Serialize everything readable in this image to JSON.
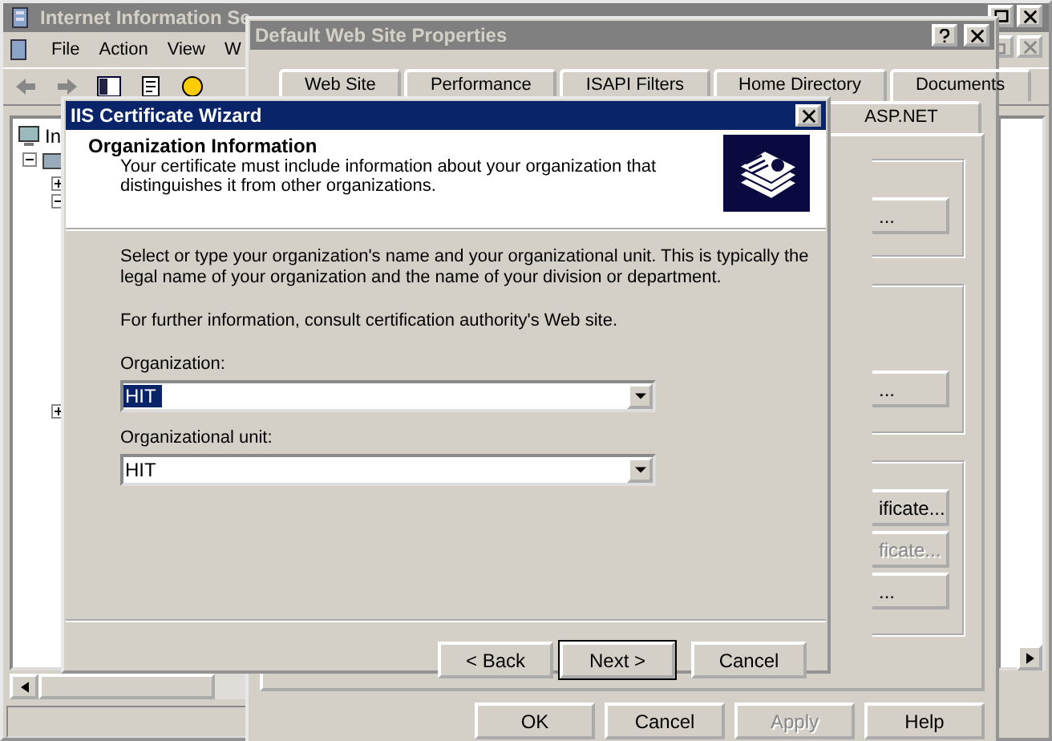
{
  "manager": {
    "title": "Internet Information Se",
    "menu": [
      "File",
      "Action",
      "View",
      "W"
    ],
    "tree": [
      {
        "label": "In",
        "children": [
          {
            "expanded": true,
            "children": [
              {
                "expanded": false
              },
              {
                "expanded": true
              },
              {
                "expanded": false
              }
            ]
          }
        ]
      }
    ]
  },
  "properties": {
    "title": "Default Web Site Properties",
    "tabs": [
      "Web Site",
      "Performance",
      "ISAPI Filters",
      "Home Directory",
      "Documents"
    ],
    "second_row_tabs": [
      "ASP.NET"
    ],
    "groups": [
      {
        "buttons": [
          {
            "label": "...",
            "disabled": false
          }
        ]
      },
      {
        "buttons": [
          {
            "label": "...",
            "disabled": false
          }
        ]
      },
      {
        "buttons": [
          {
            "label": "ificate...",
            "disabled": false
          },
          {
            "label": "ficate...",
            "disabled": true
          },
          {
            "label": "...",
            "disabled": false
          }
        ]
      }
    ],
    "buttons": [
      {
        "label": "OK",
        "disabled": false
      },
      {
        "label": "Cancel",
        "disabled": false
      },
      {
        "label": "Apply",
        "disabled": true
      },
      {
        "label": "Help",
        "disabled": false
      }
    ]
  },
  "wizard": {
    "title": "IIS Certificate Wizard",
    "heading": "Organization Information",
    "subtitle": "Your certificate must include information about your organization that distinguishes it from other organizations.",
    "paragraphs": [
      "Select or type your organization's name and your organizational unit. This is typically the legal name of your organization and the name of your division or department.",
      "For further information, consult certification authority's Web site."
    ],
    "fields": [
      {
        "label": "Organization:",
        "value": "HIT",
        "selected": true
      },
      {
        "label": "Organizational unit:",
        "value": "HIT",
        "selected": false
      }
    ],
    "buttons": [
      {
        "label": "< Back",
        "default": false
      },
      {
        "label": "Next >",
        "default": true
      },
      {
        "label": "Cancel",
        "default": false
      }
    ]
  }
}
